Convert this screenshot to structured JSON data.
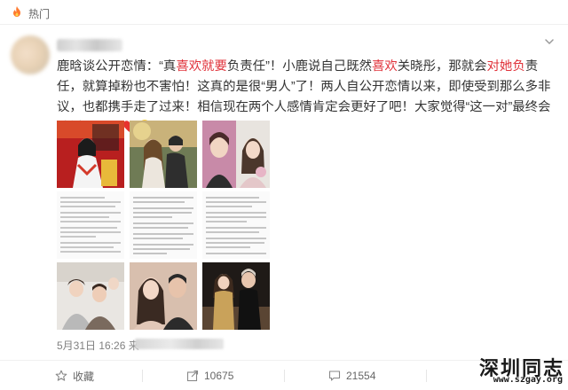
{
  "tag": {
    "label": "热门",
    "icon": "fire-icon"
  },
  "post": {
    "segments": [
      {
        "text": "鹿晗谈公开恋情：“真",
        "hl": false
      },
      {
        "text": "喜欢就要",
        "hl": true
      },
      {
        "text": "负责任”！小鹿说自己既然",
        "hl": false
      },
      {
        "text": "喜欢",
        "hl": true
      },
      {
        "text": "关晓彤，那就会",
        "hl": false
      },
      {
        "text": "对她负",
        "hl": true
      },
      {
        "text": "责任，就算掉粉也不害怕！这真的是很“男人”了！两人自公开恋情以来，即使受到那么多非议，也都携手走了过来！相信现在两个人感情肯定会更好了吧！大家觉得“这一对”最终会结婚吗？",
        "hl": false
      }
    ],
    "emojis": [
      "heart-icon",
      "heart-icon",
      "hug-emoji-icon"
    ],
    "timestamp": "5月31日 16:26 来",
    "images": [
      {
        "name": "photo-1-stage"
      },
      {
        "name": "photo-2-couple"
      },
      {
        "name": "photo-3-selfies"
      },
      {
        "name": "photo-4-article"
      },
      {
        "name": "photo-5-article"
      },
      {
        "name": "photo-6-article"
      },
      {
        "name": "photo-7-group"
      },
      {
        "name": "photo-8-couple"
      },
      {
        "name": "photo-9-couple"
      }
    ]
  },
  "actions": {
    "favorite": "收藏",
    "repost": "10675",
    "comment": "21554"
  },
  "watermark": {
    "title": "深圳同志",
    "url": "www.szgay.org"
  },
  "colors": {
    "highlight": "#e0323a",
    "text": "#333333",
    "muted": "#808080"
  }
}
